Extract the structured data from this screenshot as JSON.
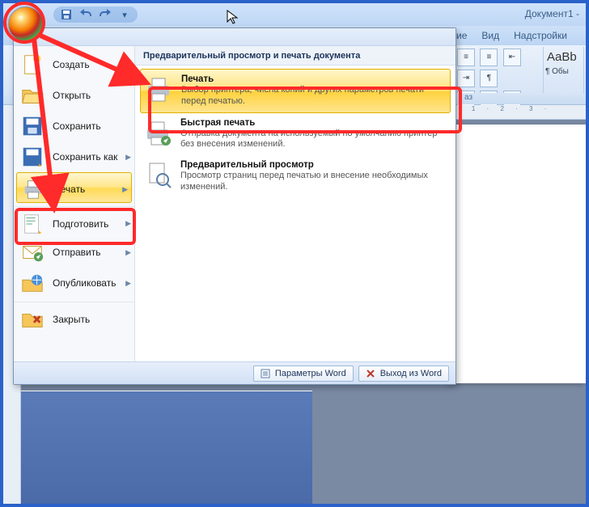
{
  "title": "Документ1 -",
  "qat": {
    "save": "save",
    "undo": "undo",
    "redo": "redo",
    "more": "▾"
  },
  "ribbon_tabs": {
    "ie": "ие",
    "view": "Вид",
    "addins": "Надстройки"
  },
  "ribbon": {
    "styles_sample": "AaBb",
    "styles_sub": "¶ Обы",
    "group_label": "аз"
  },
  "ruler_h": "· 1 · 2 · 3 ·",
  "menu": {
    "header": "Предварительный просмотр и печать документа",
    "left": [
      {
        "label": "Создать"
      },
      {
        "label": "Открыть"
      },
      {
        "label": "Сохранить"
      },
      {
        "label": "Сохранить как",
        "has_arrow": true
      },
      {
        "label": "Печать",
        "has_arrow": true,
        "active": true
      },
      {
        "label": "Подготовить",
        "has_arrow": true
      },
      {
        "label": "Отправить",
        "has_arrow": true
      },
      {
        "label": "Опубликовать",
        "has_arrow": true
      },
      {
        "label": "Закрыть"
      }
    ],
    "right": [
      {
        "title": "Печать",
        "desc": "Выбор принтера, числа копий и других параметров печати перед печатью.",
        "active": true
      },
      {
        "title": "Быстрая печать",
        "desc": "Отправка документа на используемый по умолчанию принтер без внесения изменений."
      },
      {
        "title": "Предварительный просмотр",
        "desc": "Просмотр страниц перед печатью и внесение необходимых изменений."
      }
    ],
    "bottom": {
      "options": "Параметры Word",
      "exit": "Выход из Word"
    }
  }
}
